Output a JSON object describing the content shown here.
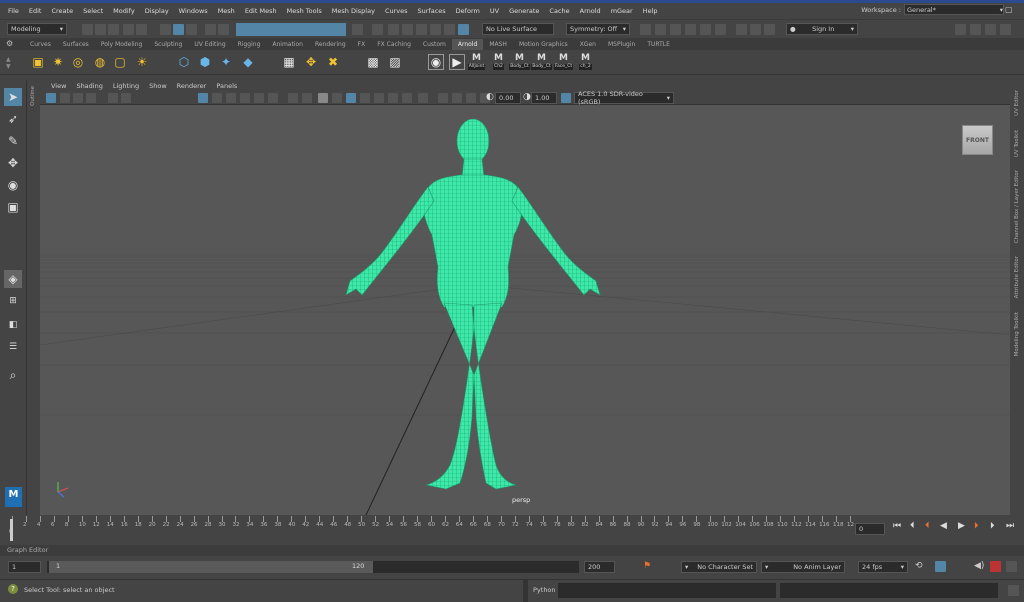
{
  "menubar": {
    "items": [
      "File",
      "Edit",
      "Create",
      "Select",
      "Modify",
      "Display",
      "Windows",
      "Mesh",
      "Edit Mesh",
      "Mesh Tools",
      "Mesh Display",
      "Curves",
      "Surfaces",
      "Deform",
      "UV",
      "Generate",
      "Cache",
      "Arnold",
      "mGear",
      "Help"
    ],
    "workspace_label": "Workspace :",
    "workspace_value": "General*"
  },
  "statusline": {
    "mode": "Modeling",
    "live_surface": "No Live Surface",
    "symmetry": "Symmetry: Off",
    "sign_in": "Sign In"
  },
  "shelf_tabs": [
    "Curves",
    "Surfaces",
    "Poly Modeling",
    "Sculpting",
    "UV Editing",
    "Rigging",
    "Animation",
    "Rendering",
    "FX",
    "FX Caching",
    "Custom",
    "Arnold",
    "MASH",
    "Motion Graphics",
    "XGen",
    "MSPlugin",
    "TURTLE"
  ],
  "shelf_active_tab": "Arnold",
  "shelf_captions": [
    "AllJoint",
    "Ch2",
    "Body_Ct",
    "Body_Ct",
    "Face_Ct",
    "ch_2"
  ],
  "outliner_label": "Outline",
  "viewport": {
    "menus": [
      "View",
      "Shading",
      "Lighting",
      "Show",
      "Renderer",
      "Panels"
    ],
    "exposure": "0.00",
    "gamma": "1.00",
    "color_space": "ACES 1.0 SDR-video (sRGB)",
    "camera_label": "persp",
    "view_cube_label": "FRONT"
  },
  "right_tabs": [
    "UV Editor",
    "UV Toolkit",
    "Channel Box / Layer Editor",
    "Attribute Editor",
    "Modeling Toolkit"
  ],
  "timeslider": {
    "ticks": [
      "0",
      "2",
      "4",
      "6",
      "8",
      "10",
      "12",
      "14",
      "16",
      "18",
      "20",
      "22",
      "24",
      "26",
      "28",
      "30",
      "32",
      "34",
      "36",
      "38",
      "40",
      "42",
      "44",
      "46",
      "48",
      "50",
      "52",
      "54",
      "56",
      "58",
      "60",
      "62",
      "64",
      "66",
      "68",
      "70",
      "72",
      "74",
      "76",
      "78",
      "80",
      "82",
      "84",
      "86",
      "88",
      "90",
      "92",
      "94",
      "96",
      "98",
      "100",
      "102",
      "104",
      "106",
      "108",
      "110",
      "112",
      "114",
      "116",
      "118",
      "12"
    ],
    "current_frame": "0"
  },
  "graph_editor_label": "Graph Editor",
  "range": {
    "start": "1",
    "inner_start": "1",
    "inner_end": "120",
    "end": "200",
    "character_set": "No Character Set",
    "anim_layer": "No Anim Layer",
    "fps": "24 fps"
  },
  "command": {
    "help_text": "Select Tool: select an object",
    "language": "Python"
  },
  "colors": {
    "mesh": "#3ee8a8",
    "wire": "#0f8a64",
    "selected": "#5285a6",
    "topbar": "#2b4a8f"
  }
}
